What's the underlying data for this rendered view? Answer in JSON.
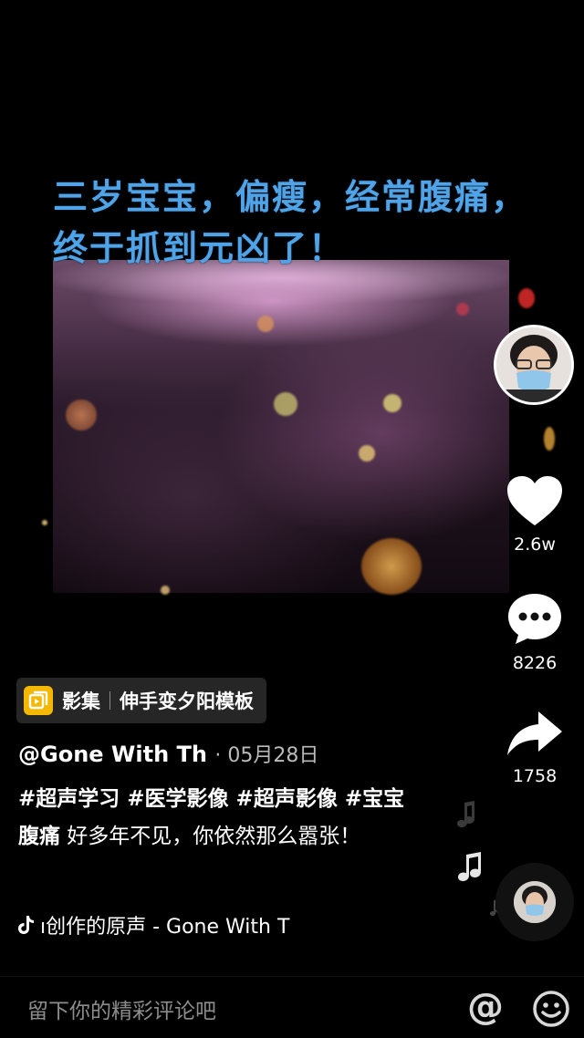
{
  "video": {
    "caption": "三岁宝宝，偏瘦，经常腹痛，终于抓到元凶了！"
  },
  "rail": {
    "like_count": "2.6w",
    "comment_count": "8226",
    "share_count": "1758"
  },
  "template_chip": {
    "label": "影集",
    "name": "伸手变夕阳模板"
  },
  "post": {
    "author": "@Gone With Th",
    "date": "· 05月28日",
    "tags": "#超声学习 #医学影像 #超声影像 #宝宝腹痛",
    "text": " 好多年不见，你依然那么嚣张！"
  },
  "music": {
    "title": "ı创作的原声 - Gone With T"
  },
  "comment": {
    "placeholder": "留下你的精彩评论吧",
    "at_symbol": "@"
  },
  "colors": {
    "caption": "#4fa3e6",
    "chip_icon": "#f5b800"
  }
}
